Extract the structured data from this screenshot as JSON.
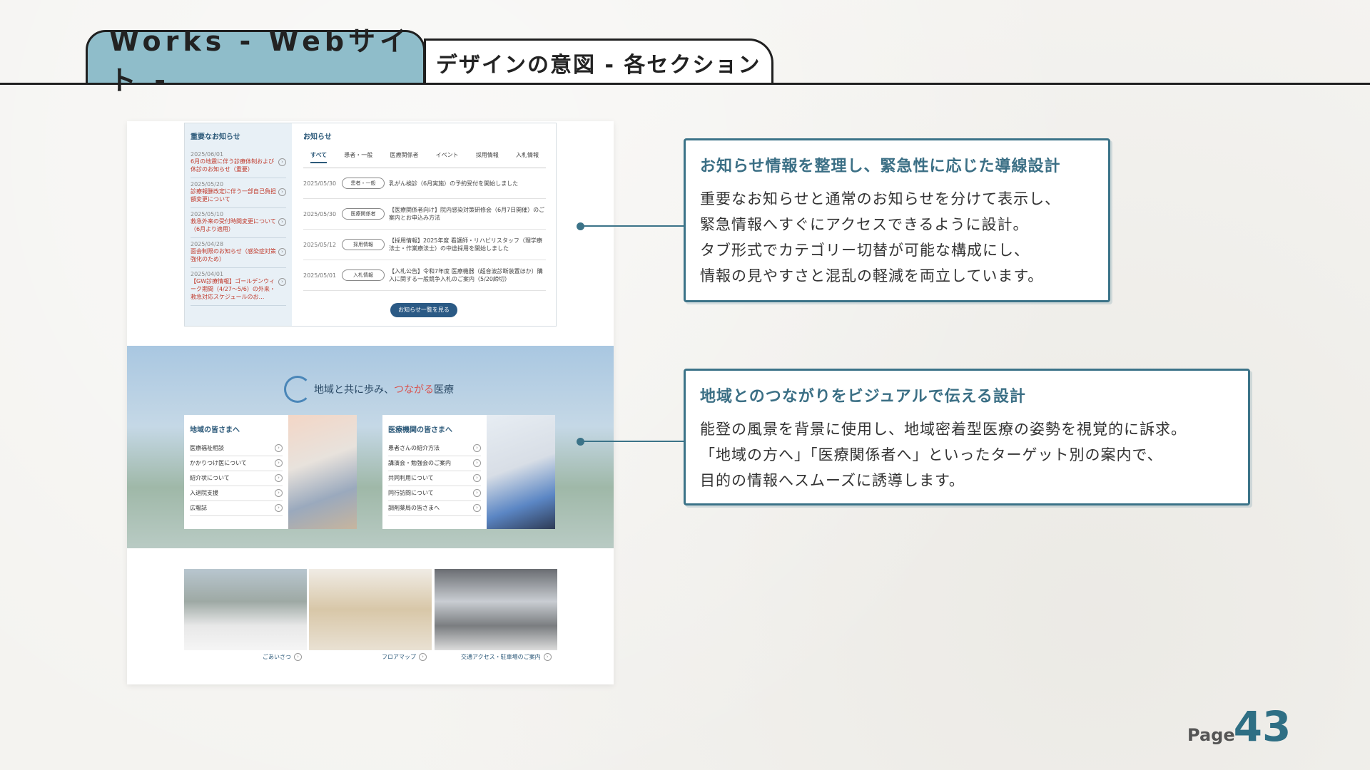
{
  "header": {
    "tab_primary": "Works - Webサイト -",
    "tab_secondary": "デザインの意図 - 各セクション"
  },
  "mock": {
    "important": {
      "title": "重要なお知らせ",
      "items": [
        {
          "date": "2025/06/01",
          "text": "6月の地震に伴う診療体制および休診のお知らせ（重要）"
        },
        {
          "date": "2025/05/20",
          "text": "診療報酬改定に伴う一部自己負担額変更について"
        },
        {
          "date": "2025/05/10",
          "text": "救急外来の受付時間変更について（6月より適用）"
        },
        {
          "date": "2025/04/28",
          "text": "面会制限のお知らせ（感染症対策強化のため）"
        },
        {
          "date": "2025/04/01",
          "text": "【GW診療情報】ゴールデンウィーク期間（4/27〜5/6）の外来・救急対応スケジュールのお…"
        }
      ]
    },
    "news": {
      "title": "お知らせ",
      "tabs": [
        "すべて",
        "患者・一般",
        "医療関係者",
        "イベント",
        "採用情報",
        "入札情報"
      ],
      "rows": [
        {
          "date": "2025/05/30",
          "tag": "患者・一般",
          "text": "乳がん検診（6月実施）の予約受付を開始しました"
        },
        {
          "date": "2025/05/30",
          "tag": "医療関係者",
          "text": "【医療関係者向け】院内感染対策研修会（6月7日開催）のご案内とお申込み方法"
        },
        {
          "date": "2025/05/12",
          "tag": "採用情報",
          "text": "【採用情報】2025年度 看護師・リハビリスタッフ（理学療法士・作業療法士）の中途採用を開始しました"
        },
        {
          "date": "2025/05/01",
          "tag": "入札情報",
          "text": "【入札公告】令和7年度 医療機器（超音波診断装置ほか）購入に関する一般競争入札のご案内（5/20締切）"
        }
      ],
      "more_button": "お知らせ一覧を見る"
    },
    "hero": {
      "title_pre": "地域と共に歩み、",
      "title_accent": "つながる",
      "title_post": "医療",
      "community_card": {
        "title": "地域の皆さまへ",
        "items": [
          "医療福祉相談",
          "かかりつけ医について",
          "紹介状について",
          "入退院支援",
          "広報誌"
        ]
      },
      "medical_card": {
        "title": "医療機関の皆さまへ",
        "items": [
          "患者さんの紹介方法",
          "講演会・勉強会のご案内",
          "共同利用について",
          "同行訪問について",
          "調剤薬局の皆さまへ"
        ]
      }
    },
    "bottom_links": [
      "ごあいさつ",
      "フロアマップ",
      "交通アクセス・駐車場のご案内"
    ]
  },
  "callouts": [
    {
      "title": "お知らせ情報を整理し、緊急性に応じた導線設計",
      "lines": [
        "重要なお知らせと通常のお知らせを分けて表示し、",
        "緊急情報へすぐにアクセスできるように設計。",
        "タブ形式でカテゴリー切替が可能な構成にし、",
        "情報の見やすさと混乱の軽減を両立しています。"
      ]
    },
    {
      "title": "地域とのつながりをビジュアルで伝える設計",
      "lines": [
        "能登の風景を背景に使用し、地域密着型医療の姿勢を視覚的に訴求。",
        "「地域の方へ」「医療関係者へ」といったターゲット別の案内で、",
        "目的の情報へスムーズに誘導します。"
      ]
    }
  ],
  "page": {
    "label": "Page",
    "number": "43"
  },
  "colors": {
    "accent": "#3b7388",
    "tab": "#8fbdca",
    "alert": "#c0392b"
  }
}
